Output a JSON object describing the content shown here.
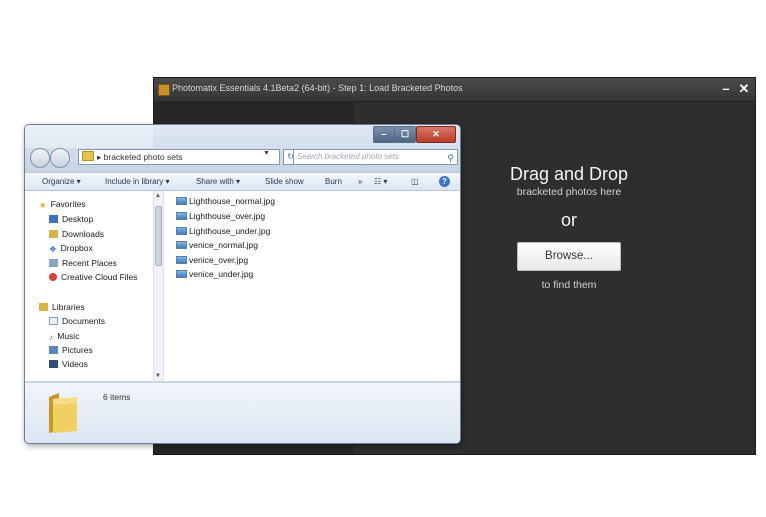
{
  "photomatix": {
    "title": "Photomatix Essentials  4.1Beta2 (64-bit) - Step 1: Load Bracketed Photos",
    "minimize": "–",
    "close": "✕",
    "drop_title": "Drag and Drop",
    "drop_subtitle": "bracketed photos here",
    "or": "or",
    "browse_label": "Browse...",
    "find_label": "to find them"
  },
  "explorer": {
    "window_buttons": {
      "minimize": "–",
      "maximize": "☐",
      "close": "✕"
    },
    "address": "bracketed photo sets",
    "search_placeholder": "Search bracketed photo sets",
    "toolbar": {
      "organize": "Organize ▾",
      "include": "Include in library ▾",
      "share": "Share with ▾",
      "slideshow": "Slide show",
      "burn": "Burn",
      "more": "»"
    },
    "nav": {
      "favorites_header": "Favorites",
      "favorites": [
        "Desktop",
        "Downloads",
        "Dropbox",
        "Recent Places",
        "Creative Cloud Files"
      ],
      "libraries_header": "Libraries",
      "libraries": [
        "Documents",
        "Music",
        "Pictures",
        "Videos"
      ]
    },
    "files": [
      "Lighthouse_normal.jpg",
      "Lighthouse_over.jpg",
      "Lighthouse_under.jpg",
      "venice_normal.jpg",
      "venice_over.jpg",
      "venice_under.jpg"
    ],
    "item_count": "6 items"
  },
  "colors": {
    "pm_background": "#2e2e2e",
    "explorer_chrome": "#cdd7e4",
    "folder": "#e7c04d"
  }
}
